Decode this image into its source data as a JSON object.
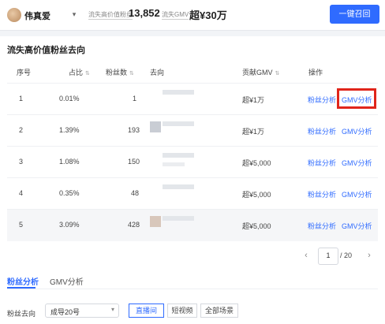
{
  "header": {
    "username": "伟真爱",
    "stat1": {
      "label": "流失高价值粉丝",
      "value": "13,852"
    },
    "stat2": {
      "label": "流失GMV",
      "value": "超¥30万"
    },
    "recall_button": "一键召回"
  },
  "section": {
    "title": "流失高价值粉丝去向"
  },
  "table": {
    "columns": [
      "序号",
      "占比",
      "粉丝数",
      "去向",
      "贡献GMV",
      "操作"
    ],
    "rows": [
      {
        "index": "1",
        "share": "0.01%",
        "fans": "1",
        "gmv": "超¥1万",
        "action_fans": "粉丝分析",
        "action_gmv": "GMV分析"
      },
      {
        "index": "2",
        "share": "1.39%",
        "fans": "193",
        "gmv": "超¥1万",
        "action_fans": "粉丝分析",
        "action_gmv": "GMV分析"
      },
      {
        "index": "3",
        "share": "1.08%",
        "fans": "150",
        "gmv": "超¥5,000",
        "action_fans": "粉丝分析",
        "action_gmv": "GMV分析"
      },
      {
        "index": "4",
        "share": "0.35%",
        "fans": "48",
        "gmv": "超¥5,000",
        "action_fans": "粉丝分析",
        "action_gmv": "GMV分析"
      },
      {
        "index": "5",
        "share": "3.09%",
        "fans": "428",
        "gmv": "超¥5,000",
        "action_fans": "粉丝分析",
        "action_gmv": "GMV分析"
      }
    ]
  },
  "pagination": {
    "current": "1",
    "total": "/ 20"
  },
  "tabs": [
    {
      "label": "粉丝分析"
    },
    {
      "label": "GMV分析"
    }
  ],
  "filter": {
    "label": "粉丝去向",
    "selected": "成导20号",
    "segments": [
      {
        "label": "直播间"
      },
      {
        "label": "短视频"
      },
      {
        "label": "全部场景"
      }
    ]
  },
  "colors": {
    "accent": "#2f6bff",
    "highlight": "#e0251b"
  }
}
